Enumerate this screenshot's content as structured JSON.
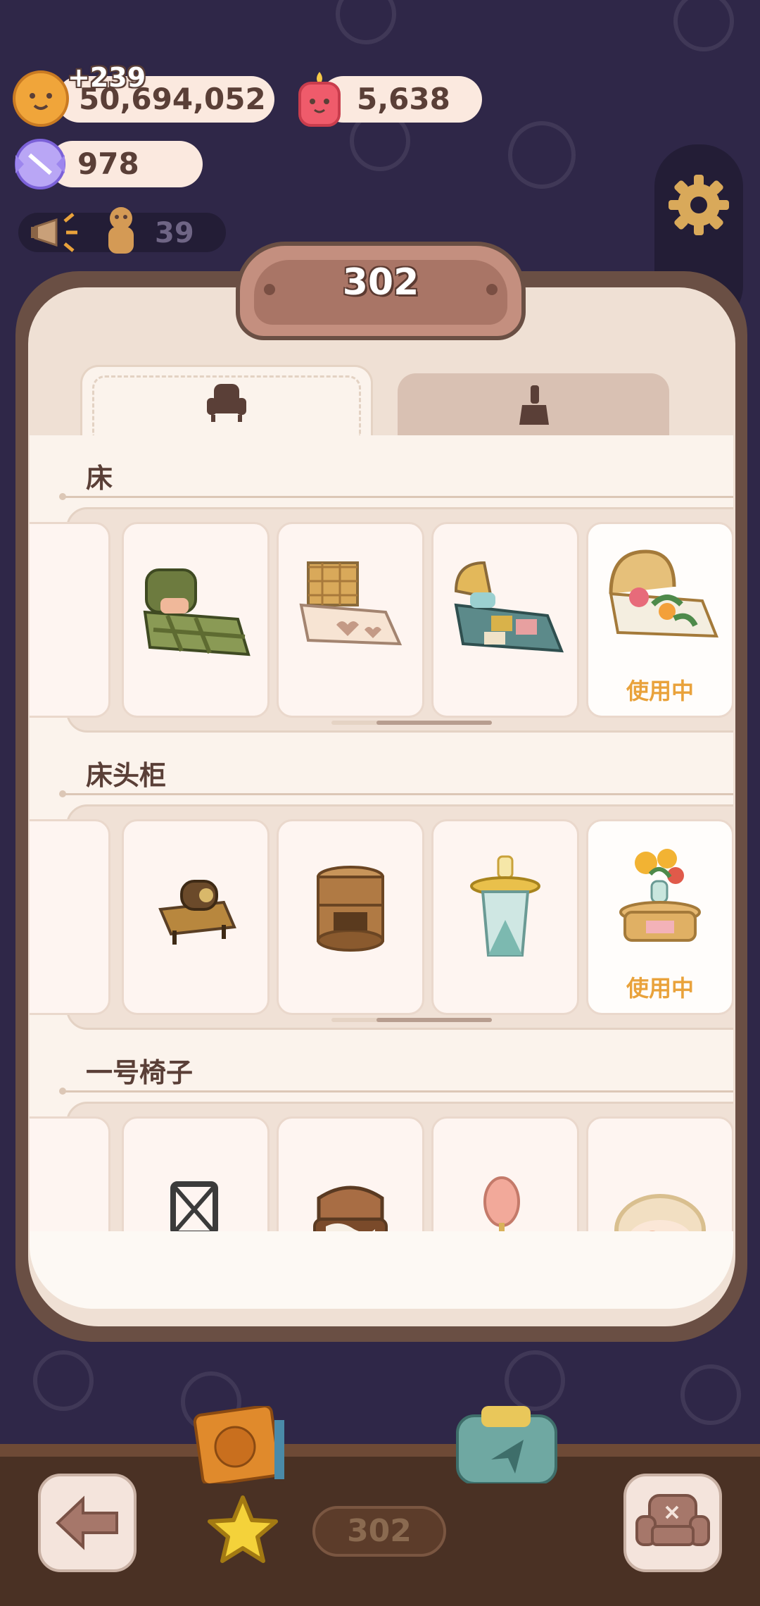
{
  "currency": {
    "coins": "50,694,052",
    "coin_gain": "+239",
    "candles": "5,638",
    "candy": "978",
    "cookie_count": "39"
  },
  "panel": {
    "title": "302",
    "tabs": [
      {
        "icon": "armchair-icon",
        "active": true
      },
      {
        "icon": "paint-brush-icon",
        "active": false
      }
    ]
  },
  "sections": [
    {
      "title": "床",
      "in_use_label": "使用中"
    },
    {
      "title": "床头柜",
      "in_use_label": "使用中"
    },
    {
      "title": "一号椅子"
    }
  ],
  "bottom": {
    "count": "302"
  },
  "colors": {
    "background": "#2f2748",
    "panel_frame": "#6a4f44",
    "accent_orange": "#e9a23b",
    "text_brown": "#5a3f37"
  }
}
